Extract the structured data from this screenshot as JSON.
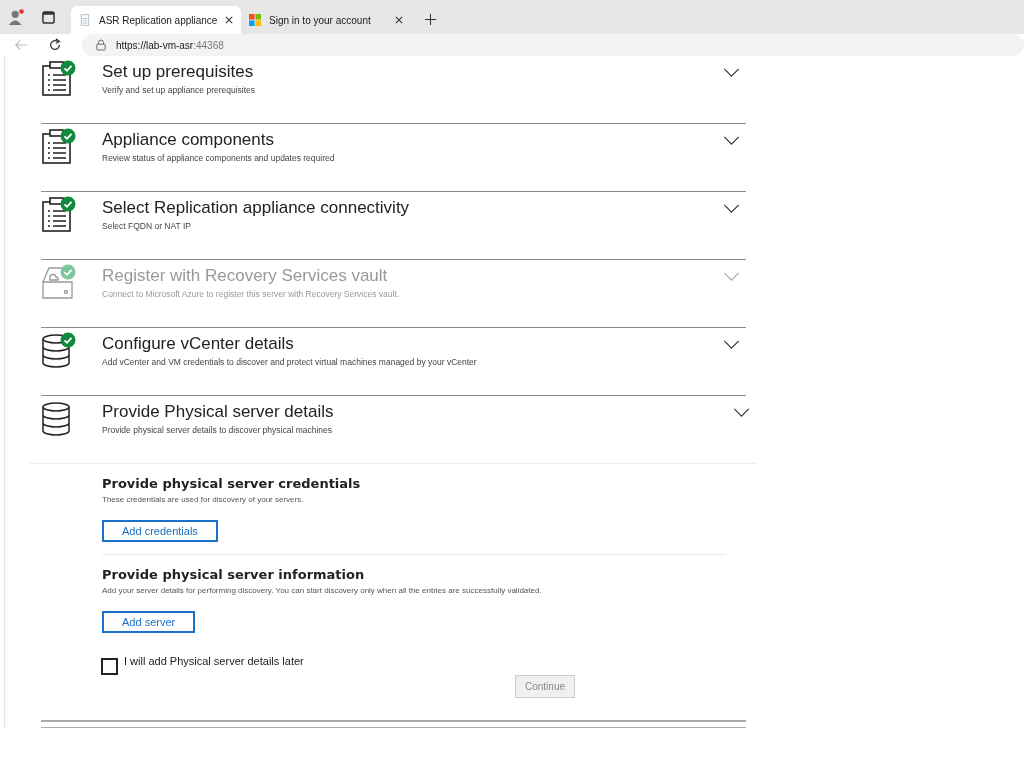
{
  "browser": {
    "tabs": [
      {
        "title": "ASR Replication appliance",
        "selected": true,
        "kind": "page"
      },
      {
        "title": "Sign in to your account",
        "selected": false,
        "kind": "ms"
      }
    ],
    "url_host": "https://lab-vm-asr",
    "url_port": ":44368"
  },
  "steps": [
    {
      "title": "Set up prerequisites",
      "subtitle": "Verify and set up appliance prerequisites",
      "kind": "clipboard",
      "completed": true,
      "disabled": false,
      "expanded": false
    },
    {
      "title": "Appliance components",
      "subtitle": "Review status of appliance components and updates required",
      "kind": "clipboard",
      "completed": true,
      "disabled": false,
      "expanded": false
    },
    {
      "title": "Select Replication appliance connectivity",
      "subtitle": "Select FQDN or NAT IP",
      "kind": "clipboard",
      "completed": true,
      "disabled": false,
      "expanded": false
    },
    {
      "title": "Register with Recovery Services vault",
      "subtitle": "Connect to Microsoft Azure to register this server with Recovery Services vault.",
      "kind": "drive",
      "completed": true,
      "disabled": true,
      "expanded": false
    },
    {
      "title": "Configure vCenter details",
      "subtitle": "Add vCenter and VM credentials to discover and protect virtual machines managed by your vCenter",
      "kind": "database",
      "completed": true,
      "disabled": false,
      "expanded": false
    },
    {
      "title": "Provide Physical server details",
      "subtitle": "Provide physical server details to discover physical machines",
      "kind": "database",
      "completed": false,
      "disabled": false,
      "expanded": true
    }
  ],
  "panel": {
    "sections": [
      {
        "heading": "Provide physical server credentials",
        "description": "These credentials are used for discovery of your servers.",
        "button": "Add credentials"
      },
      {
        "heading": "Provide physical server information",
        "description": "Add your server details for performing discovery. You can start discovery only when all the entries are successfully validated.",
        "button": "Add server"
      }
    ],
    "later_checkbox": {
      "label": "I will add Physical server details later",
      "checked": false
    },
    "continue_button": {
      "label": "Continue",
      "disabled": true
    }
  }
}
